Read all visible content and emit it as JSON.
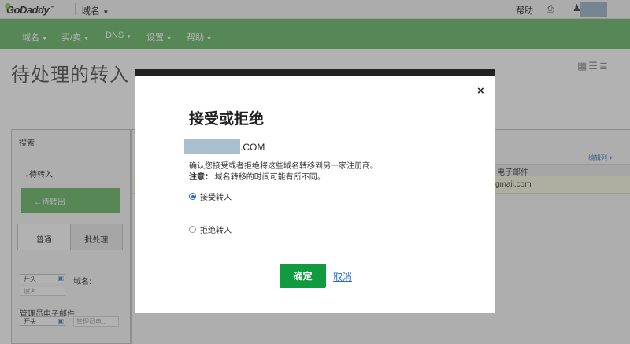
{
  "topbar": {
    "logo": "GoDaddy",
    "logo_tm": "™",
    "domain_menu": "域名",
    "help": "帮助"
  },
  "nav": {
    "items": [
      "域名",
      "买/卖",
      "DNS",
      "设置",
      "帮助"
    ]
  },
  "page": {
    "title": "待处理的转入"
  },
  "left_panel": {
    "search_header": "搜索",
    "pending_in": "待转入",
    "pending_out": "待转出",
    "tabs": [
      "普通",
      "批处理"
    ],
    "start_option": "开头",
    "domain_label": "域名:",
    "domain_placeholder": "域名",
    "admin_email_label": "管理员电子邮件:",
    "admin_email_placeholder": "管理员电..."
  },
  "right_panel": {
    "edit_columns": "编辑列",
    "email_header": "电子邮件",
    "email_value": "gmail.com"
  },
  "modal": {
    "title": "接受或拒绝",
    "domain_suffix": ".COM",
    "confirm_text": "确认您接受或者拒绝将这些域名转移到另一家注册商。",
    "note_label": "注意：",
    "note_text": "域名转移的时间可能有所不同。",
    "accept_label": "接受转入",
    "reject_label": "拒绝转入",
    "ok_label": "确定",
    "cancel_label": "取消",
    "close_glyph": "×",
    "selected": "accept"
  },
  "colors": {
    "nav_green": "#7dc17d",
    "ok_green": "#119a3f",
    "link_blue": "#2b6cd1"
  },
  "icons": [
    "printer-icon",
    "user-icon",
    "close-icon",
    "chevron-down-icon",
    "grid-view-icon",
    "list-view-icon",
    "calendar-icon"
  ]
}
